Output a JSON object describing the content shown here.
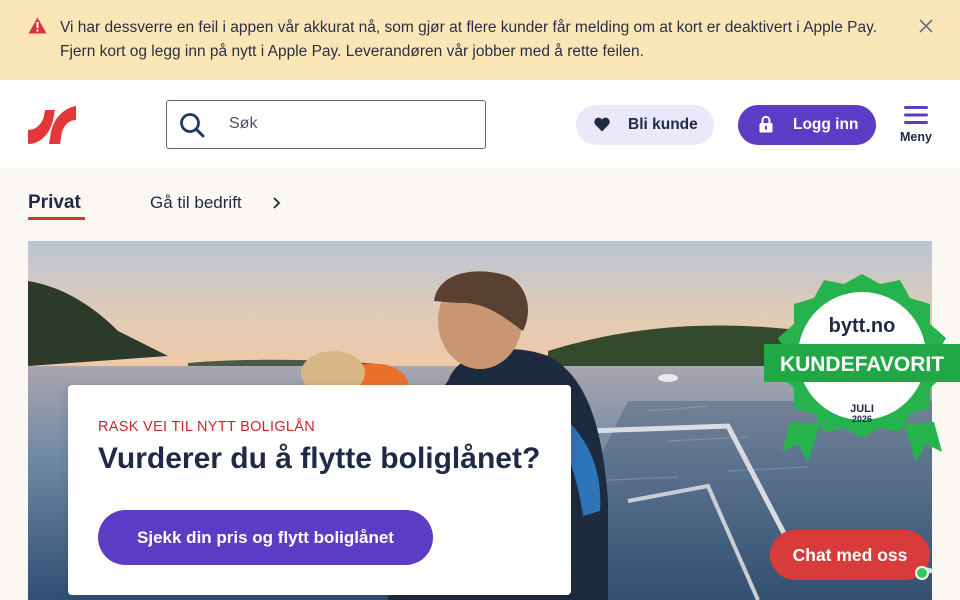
{
  "alert": {
    "icon": "warning-icon",
    "message": "Vi har dessverre en feil i appen vår akkurat nå, som gjør at flere kunder får melding om at kort er deaktivert i Apple Pay. Fjern kort og legg inn på nytt i Apple Pay. Leverandøren vår jobber med å rette feilen.",
    "close_icon": "close-icon",
    "background": "#fbe6b8",
    "icon_color": "#d4343c"
  },
  "header": {
    "logo": "brand-logo",
    "search": {
      "placeholder": "Søk",
      "value": "",
      "icon": "search-icon"
    },
    "become_customer": {
      "label": "Bli kunde",
      "icon": "heart-icon"
    },
    "login": {
      "label": "Logg inn",
      "icon": "lock-icon"
    },
    "menu": {
      "label": "Meny",
      "icon": "hamburger-icon"
    }
  },
  "tabs": {
    "private": "Privat",
    "business": "Gå til bedrift",
    "business_icon": "chevron-right-icon"
  },
  "hero": {
    "eyebrow": "RASK VEI TIL NYTT BOLIGLÅN",
    "title": "Vurderer du å flytte boliglånet?",
    "cta": "Sjekk din pris og flytt boliglånet"
  },
  "badge": {
    "brand": "bytt.no",
    "ribbon": "KUNDEFAVORIT",
    "month": "JULI",
    "year": "2026"
  },
  "chat": {
    "label": "Chat med oss",
    "status": "online"
  },
  "colors": {
    "brand_red": "#d4343c",
    "primary_purple": "#5b3cc4",
    "light_purple": "#ece8fb",
    "navy_text": "#1f2a44",
    "badge_green": "#1fb24a",
    "chat_red": "#d93a3a"
  }
}
